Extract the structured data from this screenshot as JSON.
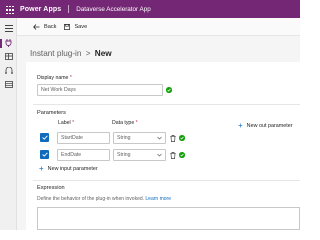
{
  "header": {
    "brand": "Power Apps",
    "app_title": "Dataverse Accelerator App"
  },
  "nav": {
    "icons": [
      "hamburger-icon",
      "plug-icon",
      "table-icon",
      "pipeline-icon",
      "grid-icon"
    ]
  },
  "commands": {
    "back_label": "Back",
    "save_label": "Save"
  },
  "breadcrumb": {
    "parent": "Instant plug-in",
    "separator": ">",
    "current": "New"
  },
  "form": {
    "display_name": {
      "label": "Display name",
      "required_mark": "*",
      "value": "Net Work Days"
    },
    "parameters": {
      "title": "Parameters",
      "col_label": "Label",
      "col_type": "Data type",
      "required_mark": "*",
      "rows": [
        {
          "label": "StartDate",
          "type": "String"
        },
        {
          "label": "EndDate",
          "type": "String"
        }
      ],
      "add_input": "New input parameter",
      "add_output": "New out parameter"
    },
    "expression": {
      "title": "Expression",
      "description": "Define the behavior of the plug-in when invoked.",
      "learn_more": "Learn more"
    }
  },
  "colors": {
    "header": "#742774",
    "accent": "#0f6cbd",
    "success": "#13a10e",
    "required": "#c4314b"
  }
}
